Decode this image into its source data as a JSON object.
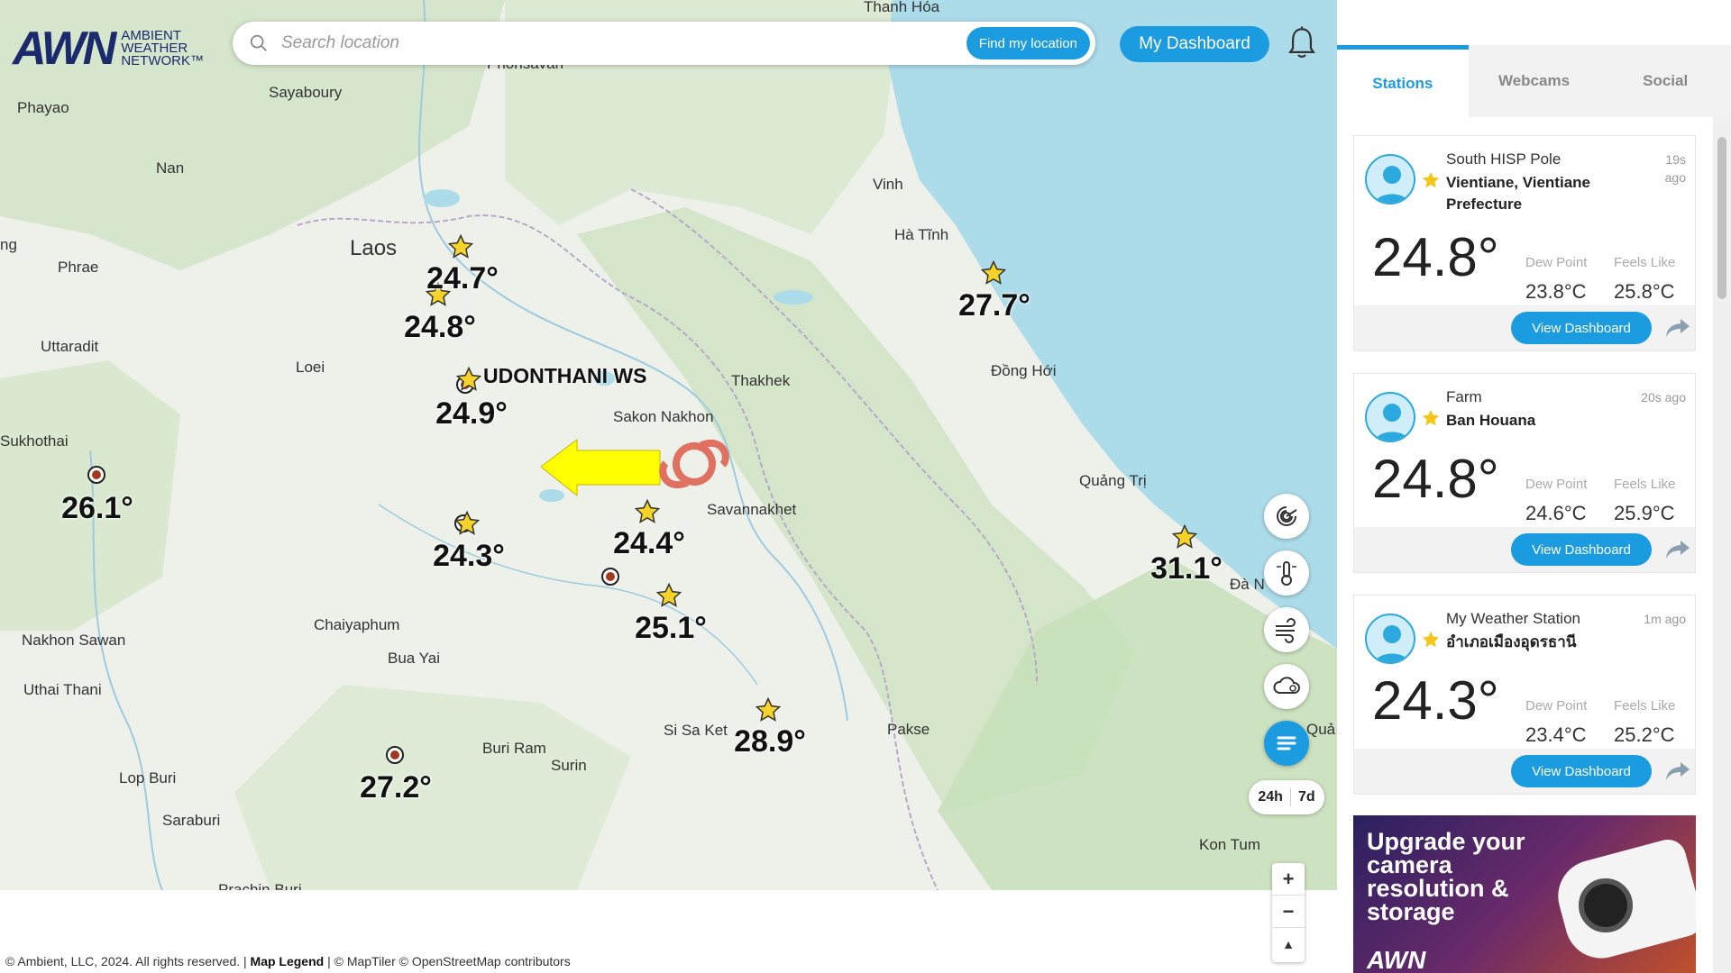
{
  "header": {
    "logo_text": "AWN",
    "logo_sub_1": "AMBIENT",
    "logo_sub_2": "WEATHER",
    "logo_sub_3": "NETWORK™",
    "search_placeholder": "Search location",
    "find_location_label": "Find my location",
    "dashboard_label": "My Dashboard"
  },
  "map": {
    "places": [
      {
        "name": "Thanh Hóa",
        "big": false
      },
      {
        "name": "Phonsavan",
        "big": false
      },
      {
        "name": "Sayaboury",
        "big": false
      },
      {
        "name": "Phayao",
        "big": false
      },
      {
        "name": "Nan",
        "big": false
      },
      {
        "name": "Vinh",
        "big": false
      },
      {
        "name": "Hà Tĩnh",
        "big": false
      },
      {
        "name": "Laos",
        "big": true
      },
      {
        "name": "Phrae",
        "big": false
      },
      {
        "name": "ng",
        "big": false
      },
      {
        "name": "Uttaradit",
        "big": false
      },
      {
        "name": "Loei",
        "big": false
      },
      {
        "name": "Thakhek",
        "big": false
      },
      {
        "name": "Đồng Hới",
        "big": false
      },
      {
        "name": "Sakon Nakhon",
        "big": false
      },
      {
        "name": "Sukhothai",
        "big": false
      },
      {
        "name": "Quảng Trị",
        "big": false
      },
      {
        "name": "Savannakhet",
        "big": false
      },
      {
        "name": "Đà N",
        "big": false
      },
      {
        "name": "Chaiyaphum",
        "big": false
      },
      {
        "name": "Nakhon Sawan",
        "big": false
      },
      {
        "name": "Bua Yai",
        "big": false
      },
      {
        "name": "Uthai Thani",
        "big": false
      },
      {
        "name": "Si Sa Ket",
        "big": false
      },
      {
        "name": "Pakse",
        "big": false
      },
      {
        "name": "Quả",
        "big": false
      },
      {
        "name": "Buri Ram",
        "big": false
      },
      {
        "name": "Surin",
        "big": false
      },
      {
        "name": "Lop Buri",
        "big": false
      },
      {
        "name": "Saraburi",
        "big": false
      },
      {
        "name": "Kon Tum",
        "big": false
      },
      {
        "name": "Prachin Buri",
        "big": false
      }
    ],
    "temps": [
      "24.7°",
      "24.8°",
      "24.9°",
      "26.1°",
      "24.3°",
      "24.4°",
      "25.1°",
      "27.7°",
      "31.1°",
      "28.9°",
      "27.2°"
    ],
    "station_label": "UDONTHANI WS",
    "range_24h": "24h",
    "range_7d": "7d",
    "zoom_in": "+",
    "zoom_out": "−",
    "compass": "▲"
  },
  "footer": {
    "copyright": "© Ambient, LLC, 2024. All rights reserved. | ",
    "legend": "Map Legend",
    "credits": " | © MapTiler © OpenStreetMap contributors"
  },
  "panel": {
    "tabs": [
      "Stations",
      "Webcams",
      "Social"
    ],
    "active_tab": "Stations",
    "stations": [
      {
        "name": "South HISP Pole",
        "location": "Vientiane, Vientiane Prefecture",
        "ago": "19s\nago",
        "temp": "24.8°",
        "dew_label": "Dew Point",
        "dew": "23.8°C",
        "feels_label": "Feels Like",
        "feels": "25.8°C",
        "button": "View Dashboard"
      },
      {
        "name": "Farm",
        "location": "Ban Houana",
        "ago": "20s ago",
        "temp": "24.8°",
        "dew_label": "Dew Point",
        "dew": "24.6°C",
        "feels_label": "Feels Like",
        "feels": "25.9°C",
        "button": "View Dashboard"
      },
      {
        "name": "My Weather Station",
        "location": "อำเภอเมืองอุดรธานี",
        "ago": "1m ago",
        "temp": "24.3°",
        "dew_label": "Dew Point",
        "dew": "23.4°C",
        "feels_label": "Feels Like",
        "feels": "25.2°C",
        "button": "View Dashboard"
      }
    ],
    "ad": {
      "text": "Upgrade your camera resolution & storage",
      "logo": "AWN"
    }
  },
  "colors": {
    "accent": "#1c9ce0",
    "star": "#f5d328",
    "water": "#acdbe9",
    "land": "#eef0ea",
    "forest": "#cfe3c4"
  }
}
